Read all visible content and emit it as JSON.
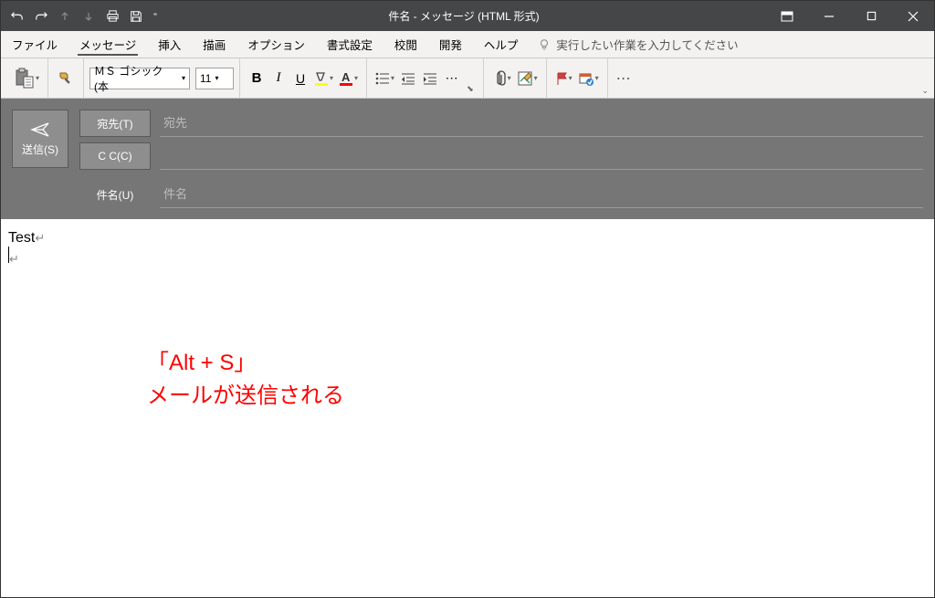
{
  "titlebar": {
    "title": "件名  -  メッセージ (HTML 形式)"
  },
  "menu": {
    "file": "ファイル",
    "message": "メッセージ",
    "insert": "挿入",
    "draw": "描画",
    "options": "オプション",
    "format": "書式設定",
    "review": "校閲",
    "developer": "開発",
    "help": "ヘルプ",
    "tellme": "実行したい作業を入力してください"
  },
  "ribbon": {
    "font_name": "ＭＳ ゴシック (本",
    "font_size": "11"
  },
  "header": {
    "send": "送信(S)",
    "to_btn": "宛先(T)",
    "to_placeholder": "宛先",
    "cc_btn": "C C(C)",
    "subject_label": "件名(U)",
    "subject_placeholder": "件名"
  },
  "body": {
    "line1": "Test",
    "annotation_l1": "「Alt + S」",
    "annotation_l2": "メールが送信される"
  }
}
